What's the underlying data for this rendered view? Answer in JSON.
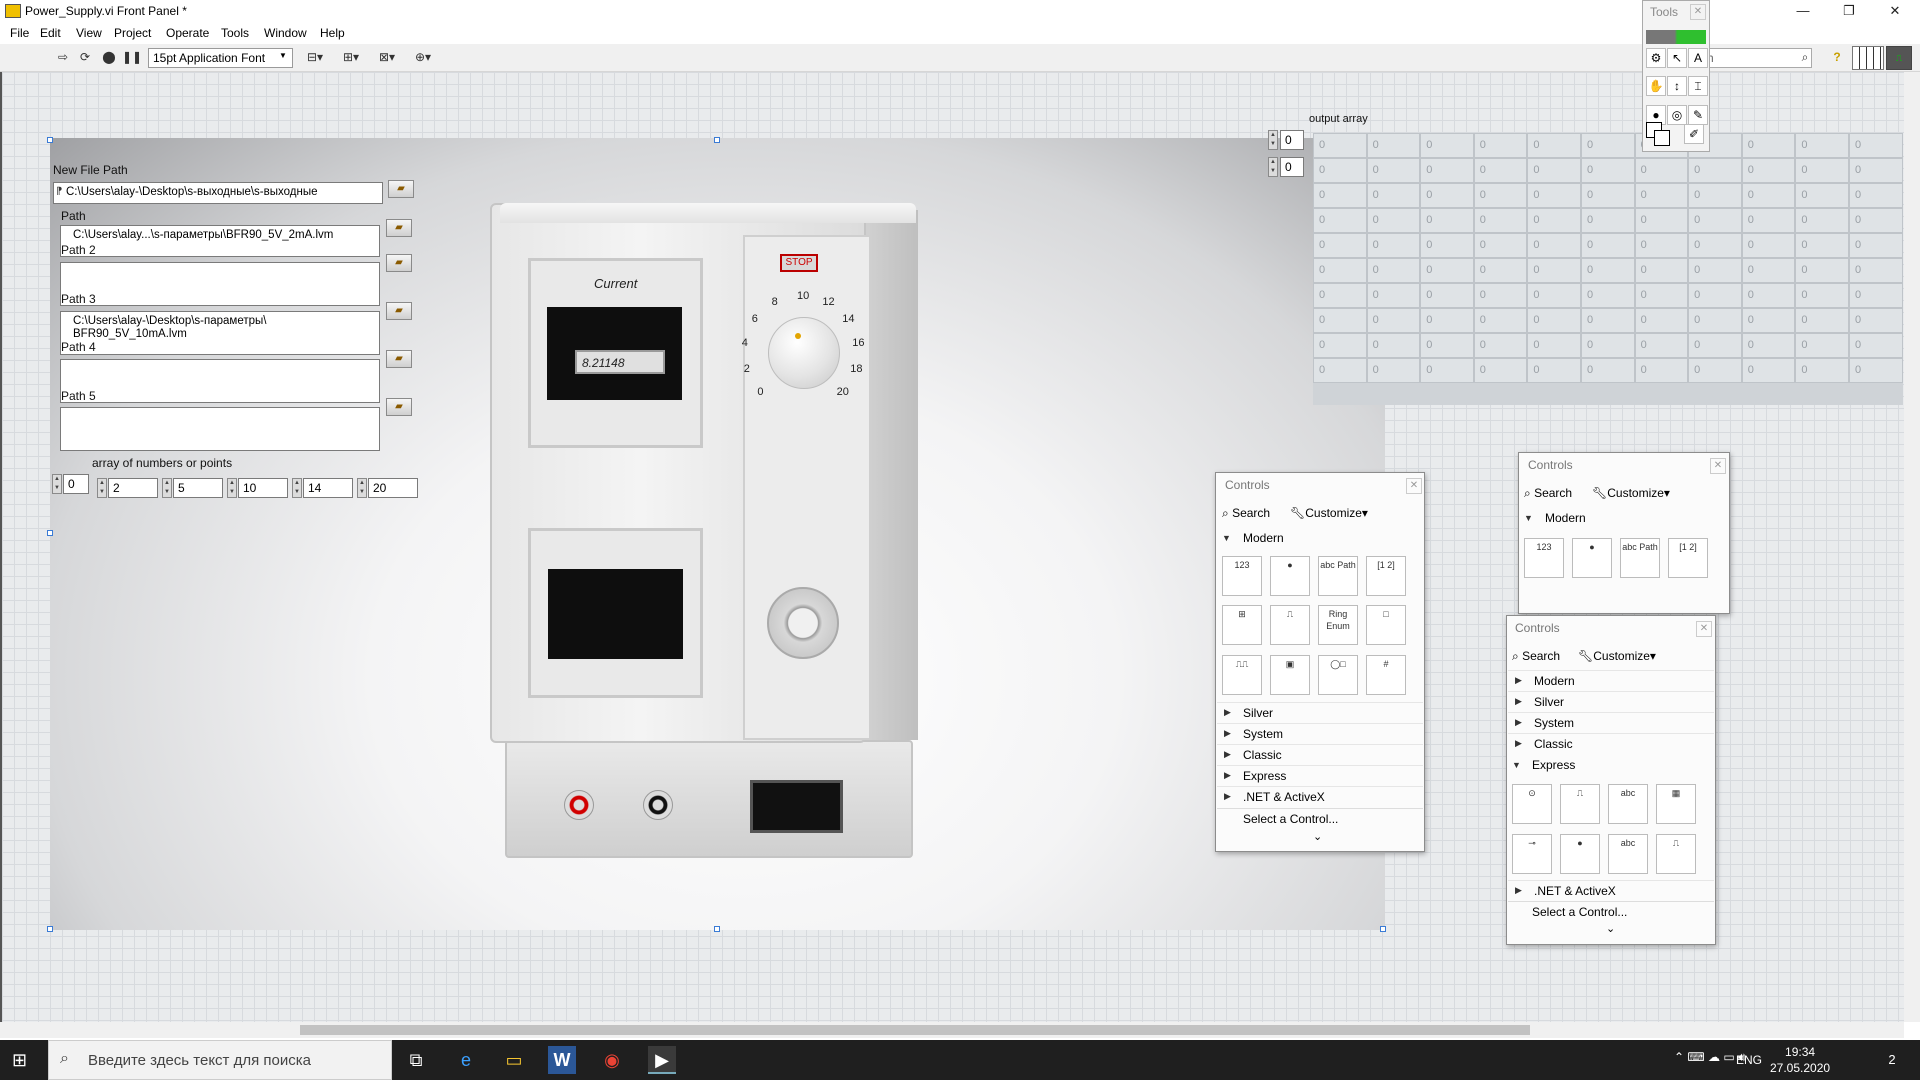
{
  "window": {
    "title": "Power_Supply.vi Front Panel *",
    "controls": [
      "—",
      "❐",
      "✕"
    ]
  },
  "menu": [
    "File",
    "Edit",
    "View",
    "Project",
    "Operate",
    "Tools",
    "Window",
    "Help"
  ],
  "toolbar": {
    "font_select": "15pt Application Font",
    "search_placeholder": "rch",
    "help_icon": "?"
  },
  "front_panel": {
    "new_file_path_label": "New File Path",
    "new_file_path_value": "C:\\Users\\alay-\\Desktop\\s-выходные\\s-выходные",
    "paths": [
      {
        "label": "Path",
        "value": "C:\\Users\\alay...\\s-параметры\\BFR90_5V_2mA.lvm"
      },
      {
        "label": "Path 2",
        "value": ""
      },
      {
        "label": "Path 3",
        "value": "C:\\Users\\alay-\\Desktop\\s-параметры\\\nBFR90_5V_10mA.lvm"
      },
      {
        "label": "Path 4",
        "value": ""
      },
      {
        "label": "Path 5",
        "value": ""
      }
    ],
    "array_label": "array of numbers or points",
    "array_index": "0",
    "array_values": [
      "2",
      "5",
      "10",
      "14",
      "20"
    ],
    "power_supply": {
      "current_label": "Current",
      "readout": "8.21148",
      "stop_label": "STOP",
      "dial_scale": [
        "0",
        "2",
        "4",
        "6",
        "8",
        "10",
        "12",
        "14",
        "16",
        "18",
        "20"
      ],
      "dial_value": 10
    },
    "output_array": {
      "label": "output array",
      "row_index": "0",
      "col_index": "0",
      "rows": 10,
      "cols": 11,
      "cell_value": "0"
    }
  },
  "tools_palette": {
    "title": "Tools",
    "tools": [
      "⚙",
      "↖",
      "A",
      "✋",
      "↕",
      "⌶",
      "●",
      "◎",
      "✎",
      "■",
      "✐",
      ""
    ]
  },
  "controls_palette_1": {
    "title": "Controls",
    "search": "Search",
    "customize": "Customize▾",
    "open_category": "Modern",
    "icons": [
      "123",
      "●",
      "abc Path",
      "[1 2]",
      "⊞",
      "⎍",
      "Ring Enum",
      "□",
      "⎍⎍",
      "▣",
      "◯□",
      "#"
    ],
    "categories": [
      "Silver",
      "System",
      "Classic",
      "Express",
      ".NET & ActiveX"
    ],
    "select": "Select a Control...",
    "more": "⌄"
  },
  "controls_palette_2": {
    "title": "Controls",
    "search": "Search",
    "customize": "Customize▾",
    "open_category": "Modern",
    "icons": [
      "123",
      "●",
      "abc Path",
      "[1 2]"
    ]
  },
  "controls_palette_3": {
    "title": "Controls",
    "search": "Search",
    "customize": "Customize▾",
    "categories_top": [
      "Modern",
      "Silver",
      "System",
      "Classic"
    ],
    "open_category": "Express",
    "icons": [
      "⊙",
      "⎍",
      "abc",
      "▦",
      "⊸",
      "●",
      "abc",
      "⎍"
    ],
    "categories_bottom": [
      ".NET & ActiveX"
    ],
    "select": "Select a Control...",
    "more": "⌄"
  },
  "taskbar": {
    "search_placeholder": "Введите здесь текст для поиска",
    "apps": [
      "⧉",
      "e",
      "▭",
      "W",
      "◉",
      "▶"
    ],
    "lang": "ENG",
    "time": "19:34",
    "date": "27.05.2020",
    "notifications": "2"
  }
}
